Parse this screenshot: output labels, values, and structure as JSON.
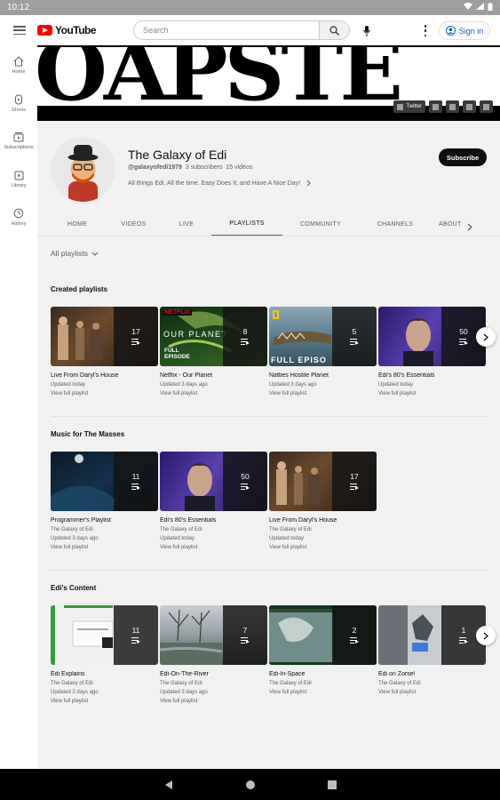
{
  "status_bar": {
    "time": "10:12"
  },
  "header": {
    "logo_text": "YouTube",
    "search_placeholder": "Search",
    "signin_label": "Sign in"
  },
  "sidebar": {
    "items": [
      {
        "label": "Home",
        "icon": "home-icon"
      },
      {
        "label": "Shorts",
        "icon": "shorts-icon"
      },
      {
        "label": "Subscriptions",
        "icon": "subscriptions-icon"
      },
      {
        "label": "Library",
        "icon": "library-icon"
      },
      {
        "label": "History",
        "icon": "history-icon"
      }
    ]
  },
  "banner": {
    "art_text": "OAPSTE",
    "chips": [
      "Twitter",
      "",
      "",
      "",
      ""
    ]
  },
  "channel": {
    "name": "The Galaxy of Edi",
    "handle": "@galaxyofedi1979",
    "subscribers": "3 subscribers",
    "videos": "15 videos",
    "description": "All things Edi, All the time. Easy Does It, and Have A Nice Day!",
    "subscribe_label": "Subscribe"
  },
  "tabs": [
    "HOME",
    "VIDEOS",
    "LIVE",
    "PLAYLISTS",
    "COMMUNITY",
    "CHANNELS",
    "ABOUT"
  ],
  "active_tab": "PLAYLISTS",
  "sort_label": "All playlists",
  "sections": [
    {
      "title": "Created playlists",
      "cards": [
        {
          "title": "Live From Daryl's House",
          "lines": [
            "Updated today"
          ],
          "count": "17",
          "link": "View full playlist"
        },
        {
          "title": "Netflix - Our Planet",
          "lines": [
            "Updated 3 days ago"
          ],
          "count": "8",
          "link": "View full playlist"
        },
        {
          "title": "Natties Hostile Planet",
          "lines": [
            "Updated 3 days ago"
          ],
          "count": "5",
          "link": "View full playlist"
        },
        {
          "title": "Edi's 80's Essentials",
          "lines": [
            "Updated today"
          ],
          "count": "50",
          "link": "View full playlist"
        }
      ]
    },
    {
      "title": "Music for The Masses",
      "cards": [
        {
          "title": "Programmer's Playlist",
          "lines": [
            "The Galaxy of Edi",
            "Updated 3 days ago"
          ],
          "count": "11",
          "link": "View full playlist"
        },
        {
          "title": "Edi's 80's Essentials",
          "lines": [
            "The Galaxy of Edi",
            "Updated today"
          ],
          "count": "50",
          "link": "View full playlist"
        },
        {
          "title": "Live From Daryl's House",
          "lines": [
            "The Galaxy of Edi",
            "Updated today"
          ],
          "count": "17",
          "link": "View full playlist"
        }
      ]
    },
    {
      "title": "Edi's Content",
      "cards": [
        {
          "title": "Edi Explains",
          "lines": [
            "The Galaxy of Edi",
            "Updated 2 days ago"
          ],
          "count": "11",
          "link": "View full playlist"
        },
        {
          "title": "Edi-On-The-River",
          "lines": [
            "The Galaxy of Edi",
            "Updated 3 days ago"
          ],
          "count": "7",
          "link": "View full playlist"
        },
        {
          "title": "Edi-In-Space",
          "lines": [
            "The Galaxy of Edi"
          ],
          "count": "2",
          "link": "View full playlist"
        },
        {
          "title": "Edi on Zorse!",
          "lines": [
            "The Galaxy of Edi"
          ],
          "count": "1",
          "link": "View full playlist"
        }
      ]
    }
  ],
  "thumb_overlay_text": {
    "netflix_brand": "NETFLIX",
    "our_planet": "OUR PLANET",
    "full_episode": "FULL EPISODE",
    "full_episo_natgeo": "FULL EPISO"
  },
  "colors": {
    "brand_red": "#ff0000",
    "link_blue": "#065fd4",
    "subscribe_bg": "#0f0f0f",
    "page_bg": "#f1f1f1"
  }
}
